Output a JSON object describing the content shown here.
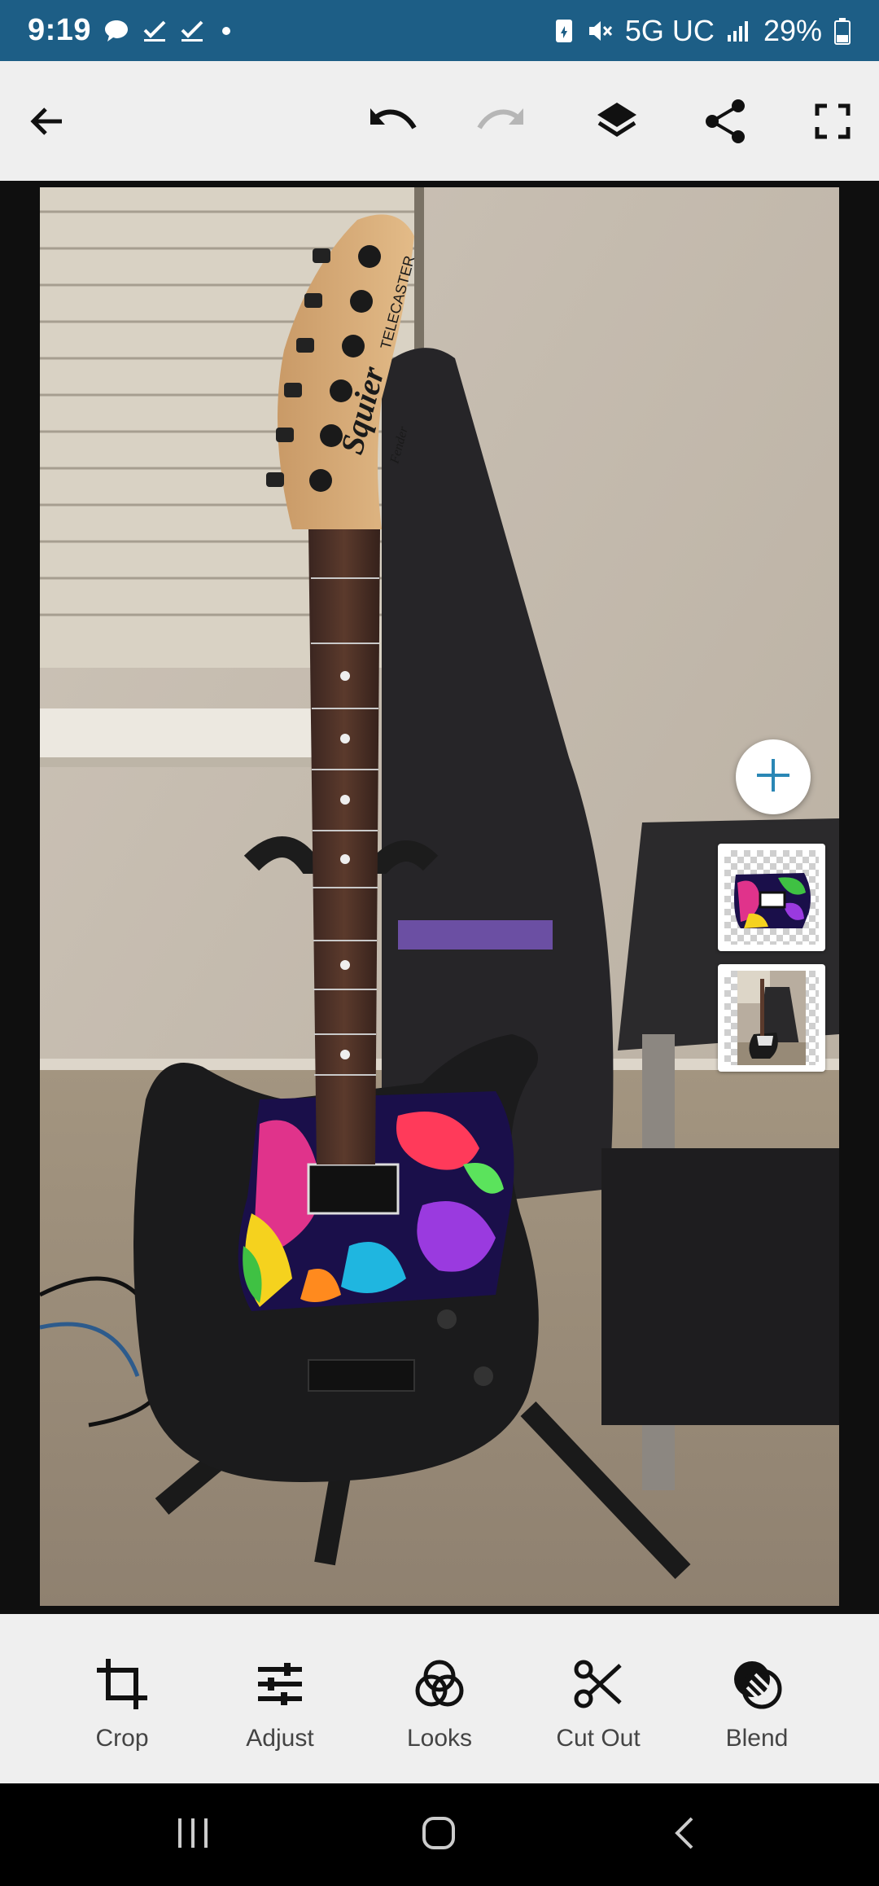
{
  "status_bar": {
    "time": "9:19",
    "network": "5G UC",
    "battery": "29%",
    "icons": [
      "chat-icon",
      "check-icon",
      "check-icon",
      "dot-icon",
      "battery-saver-icon",
      "mute-icon",
      "signal-icon",
      "battery-icon"
    ]
  },
  "toolbar": {
    "icons": [
      "back-arrow-icon",
      "undo-icon",
      "redo-icon",
      "layers-icon",
      "share-icon",
      "fullscreen-icon"
    ],
    "redo_enabled": false
  },
  "canvas": {
    "image": "photo of black telecaster guitar on stand with rainbow swirl pickguard",
    "headstock_text": "Squier",
    "headstock_model": "TELECASTER",
    "headstock_brand": "Fender"
  },
  "layers": {
    "add_icon": "plus-icon",
    "items": [
      "pickguard-swirl-layer",
      "guitar-photo-layer"
    ]
  },
  "tools": [
    {
      "label": "Crop",
      "icon": "crop-icon"
    },
    {
      "label": "Adjust",
      "icon": "sliders-icon"
    },
    {
      "label": "Looks",
      "icon": "looks-circles-icon"
    },
    {
      "label": "Cut Out",
      "icon": "scissors-icon"
    },
    {
      "label": "Blend",
      "icon": "blend-icon"
    }
  ],
  "colors": {
    "status_bar": "#1d5e86",
    "toolbar": "#efefef",
    "accent": "#1d5e86"
  }
}
